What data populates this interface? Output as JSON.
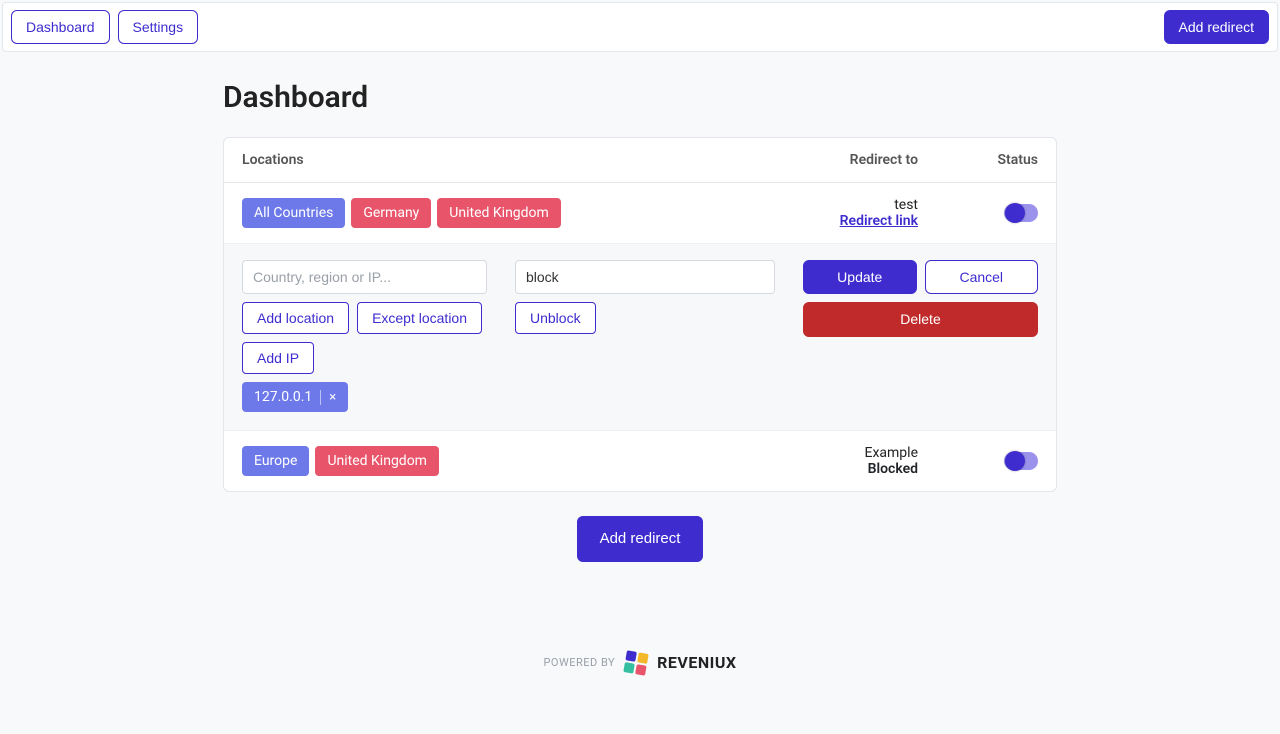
{
  "topnav": {
    "dashboard": "Dashboard",
    "settings": "Settings",
    "add_redirect": "Add redirect"
  },
  "page": {
    "title": "Dashboard"
  },
  "table": {
    "headers": {
      "locations": "Locations",
      "redirect_to": "Redirect to",
      "status": "Status"
    }
  },
  "rows": [
    {
      "tags": [
        {
          "label": "All Countries",
          "color": "blue"
        },
        {
          "label": "Germany",
          "color": "red"
        },
        {
          "label": "United Kingdom",
          "color": "red"
        }
      ],
      "redirect": {
        "name": "test",
        "sub": "Redirect link",
        "sub_is_link": true
      },
      "status_on": true
    },
    {
      "tags": [
        {
          "label": "Europe",
          "color": "blue"
        },
        {
          "label": "United Kingdom",
          "color": "red"
        }
      ],
      "redirect": {
        "name": "Example",
        "sub": "Blocked",
        "sub_is_link": false
      },
      "status_on": true
    }
  ],
  "edit": {
    "location_placeholder": "Country, region or IP...",
    "add_location": "Add location",
    "except_location": "Except location",
    "add_ip": "Add IP",
    "message_value": "block",
    "unblock": "Unblock",
    "update": "Update",
    "cancel": "Cancel",
    "delete": "Delete",
    "ip_chip": "127.0.0.1"
  },
  "bottom_button": "Add redirect",
  "footer": {
    "powered_by": "POWERED BY",
    "brand": "REVENIUX"
  },
  "logo_colors": [
    "#3E2CCF",
    "#f3b82a",
    "#33bfa0",
    "#e8556b"
  ]
}
